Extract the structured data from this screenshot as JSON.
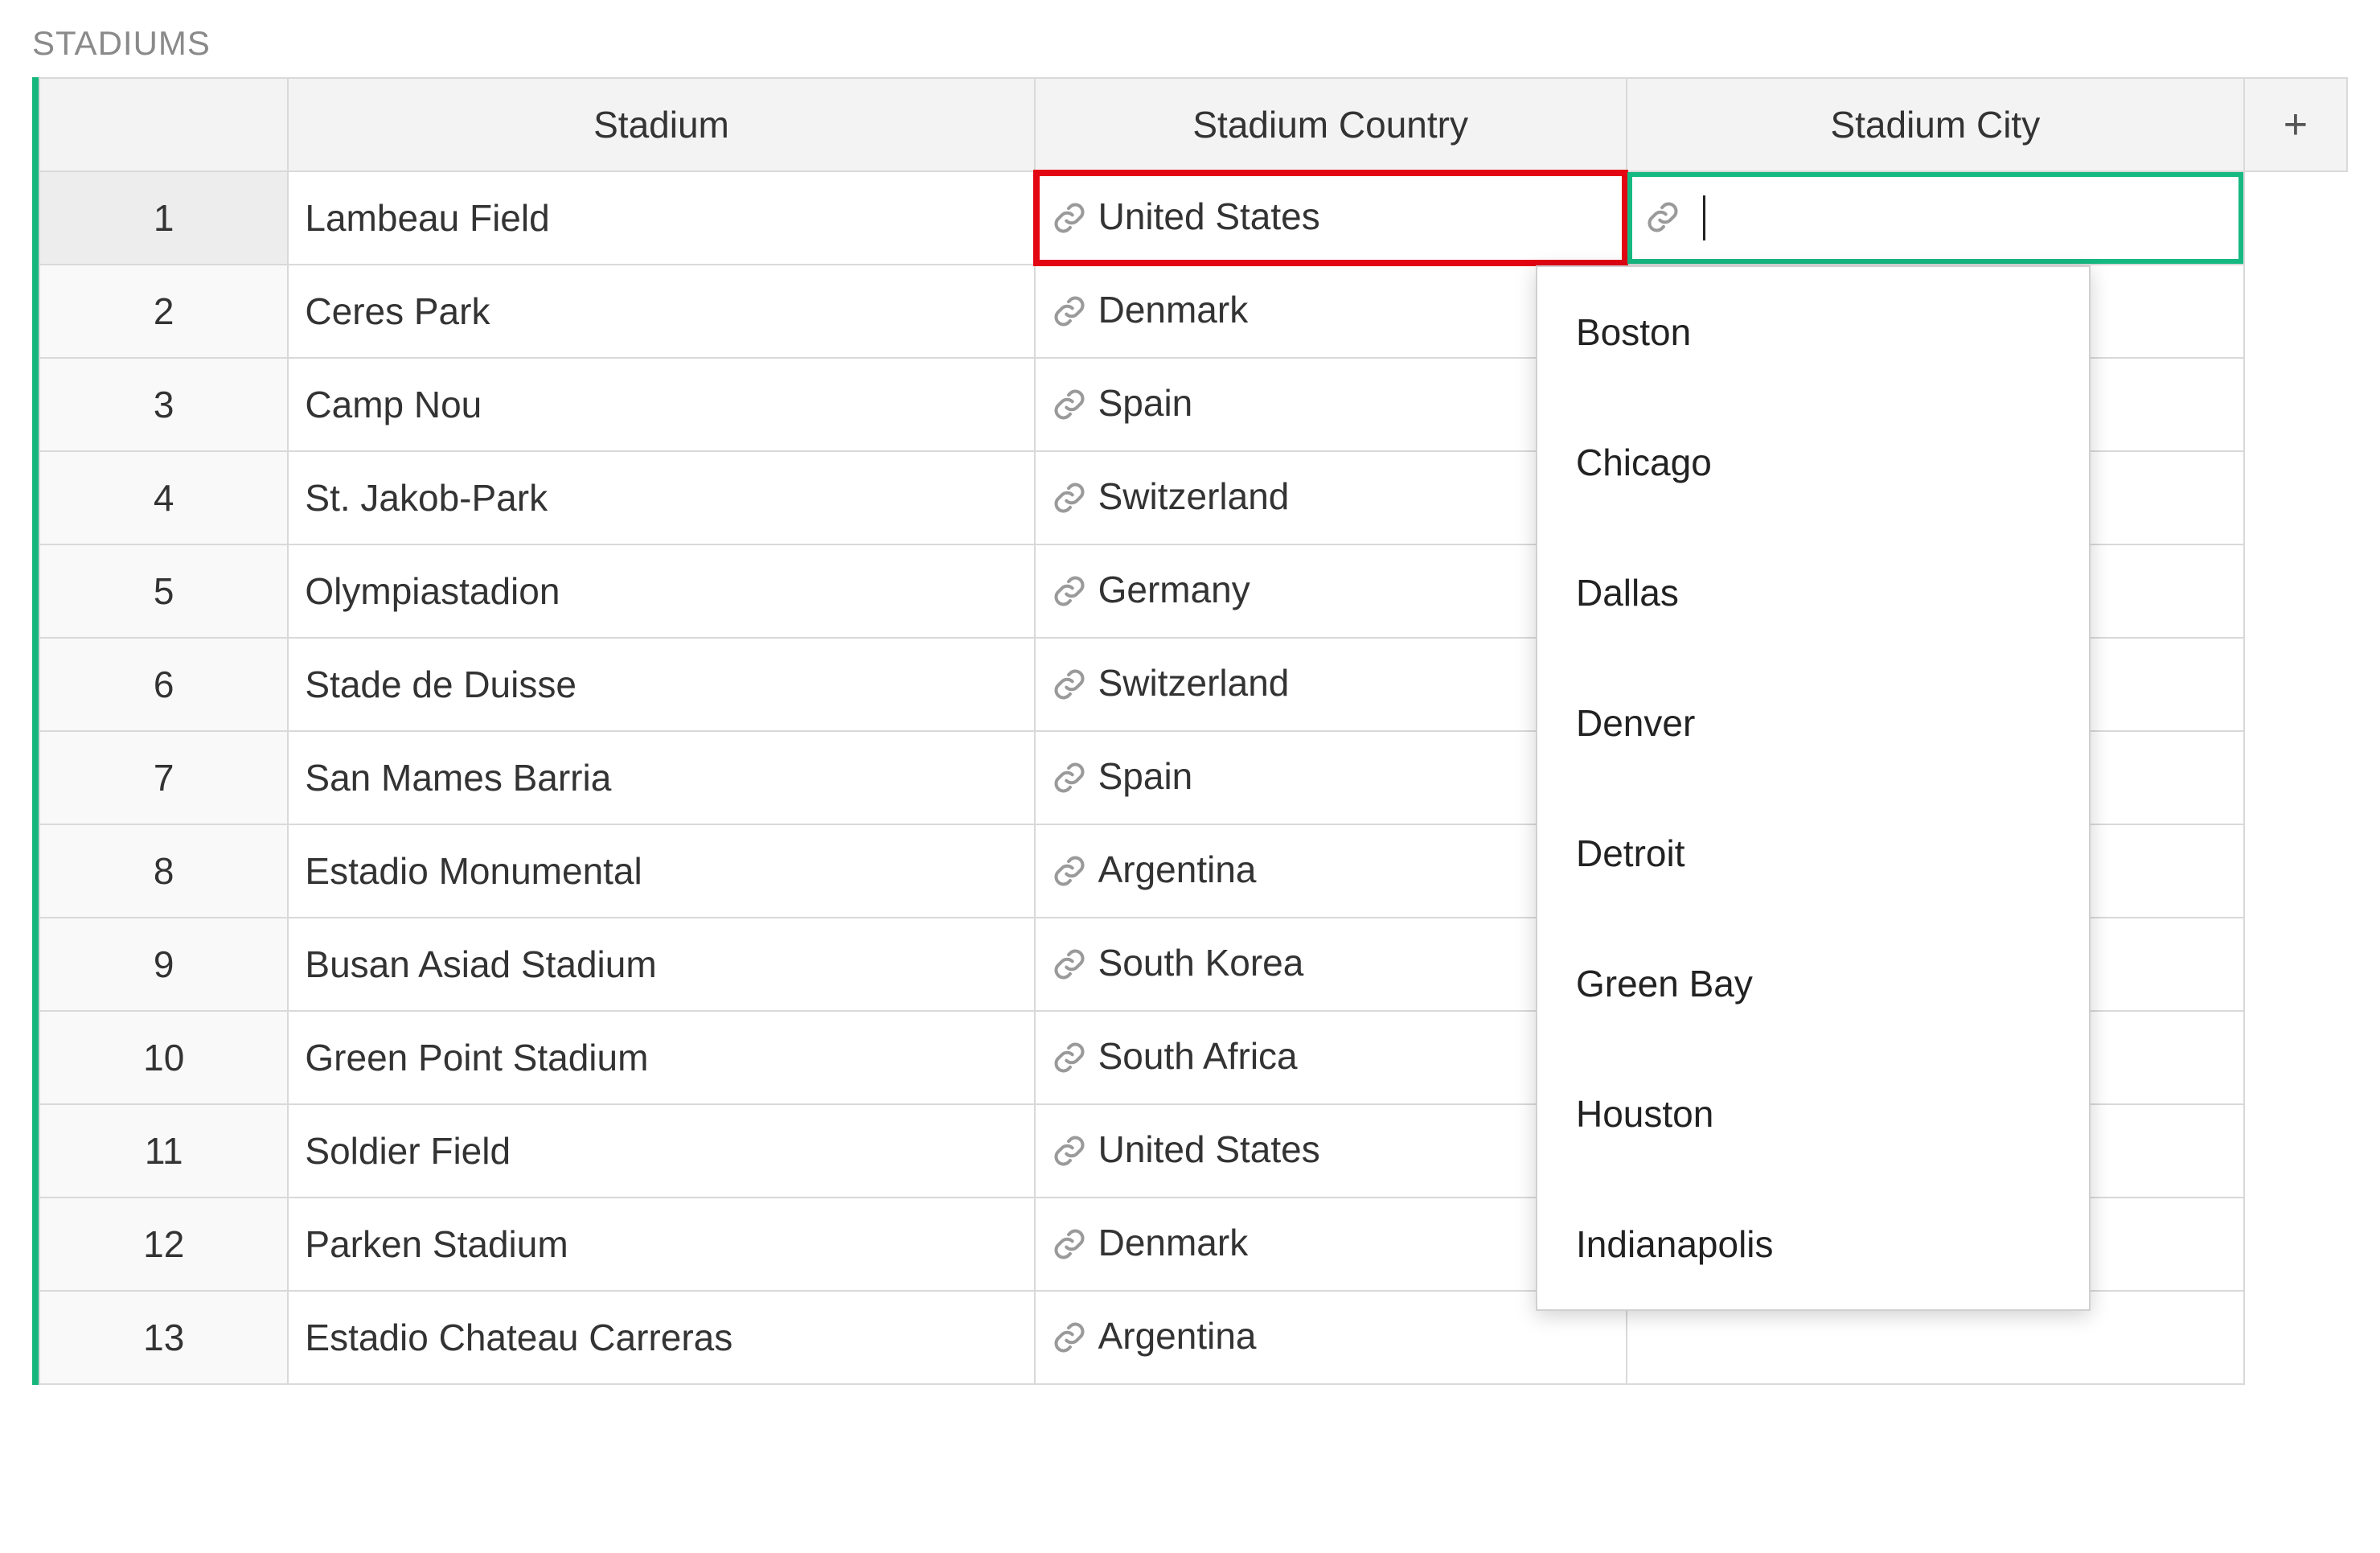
{
  "title": "STADIUMS",
  "columns": {
    "stadium": "Stadium",
    "country": "Stadium Country",
    "city": "Stadium City",
    "add": "+"
  },
  "rows": [
    {
      "n": "1",
      "stadium": "Lambeau Field",
      "country": "United States"
    },
    {
      "n": "2",
      "stadium": "Ceres Park",
      "country": "Denmark"
    },
    {
      "n": "3",
      "stadium": "Camp Nou",
      "country": "Spain"
    },
    {
      "n": "4",
      "stadium": "St. Jakob-Park",
      "country": "Switzerland"
    },
    {
      "n": "5",
      "stadium": "Olympiastadion",
      "country": "Germany"
    },
    {
      "n": "6",
      "stadium": "Stade de Duisse",
      "country": "Switzerland"
    },
    {
      "n": "7",
      "stadium": "San Mames Barria",
      "country": "Spain"
    },
    {
      "n": "8",
      "stadium": "Estadio Monumental",
      "country": "Argentina"
    },
    {
      "n": "9",
      "stadium": "Busan Asiad Stadium",
      "country": "South Korea"
    },
    {
      "n": "10",
      "stadium": "Green Point Stadium",
      "country": "South Africa"
    },
    {
      "n": "11",
      "stadium": "Soldier Field",
      "country": "United States"
    },
    {
      "n": "12",
      "stadium": "Parken Stadium",
      "country": "Denmark"
    },
    {
      "n": "13",
      "stadium": "Estadio Chateau Carreras",
      "country": "Argentina"
    }
  ],
  "dropdown": {
    "options": [
      "Boston",
      "Chicago",
      "Dallas",
      "Denver",
      "Detroit",
      "Green Bay",
      "Houston",
      "Indianapolis"
    ]
  },
  "active_city_value": ""
}
